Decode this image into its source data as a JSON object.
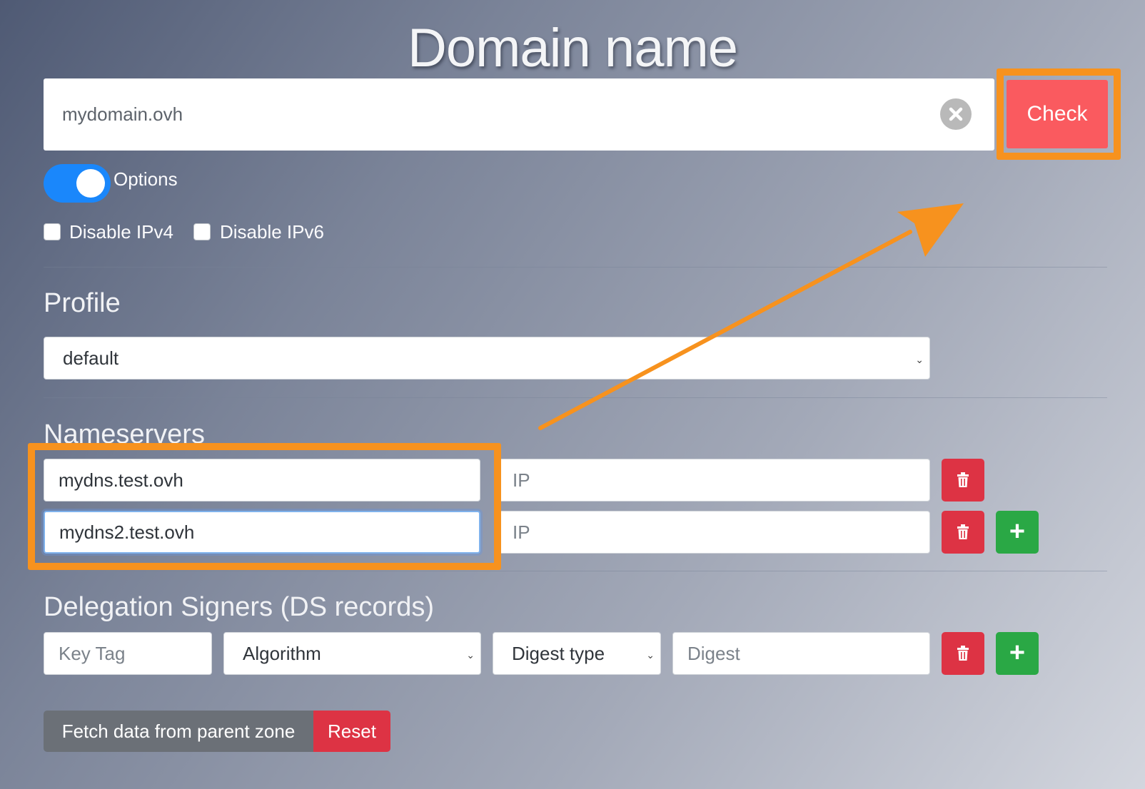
{
  "page": {
    "title": "Domain name"
  },
  "domain": {
    "value": "mydomain.ovh",
    "check_label": "Check"
  },
  "options": {
    "toggle_label": "Options",
    "toggle_on": true,
    "disable_ipv4": "Disable IPv4",
    "disable_ipv6": "Disable IPv6"
  },
  "profile": {
    "heading": "Profile",
    "selected": "default"
  },
  "nameservers": {
    "heading": "Nameservers",
    "rows": [
      {
        "name": "mydns.test.ovh",
        "ip_placeholder": "IP"
      },
      {
        "name": "mydns2.test.ovh",
        "ip_placeholder": "IP"
      }
    ]
  },
  "ds_records": {
    "heading": "Delegation Signers (DS records)",
    "key_tag_placeholder": "Key Tag",
    "algorithm_placeholder": "Algorithm",
    "digest_type_placeholder": "Digest type",
    "digest_placeholder": "Digest"
  },
  "actions": {
    "fetch_label": "Fetch data from parent zone",
    "reset_label": "Reset"
  },
  "annotation": {
    "accent_color": "#f7921e"
  }
}
